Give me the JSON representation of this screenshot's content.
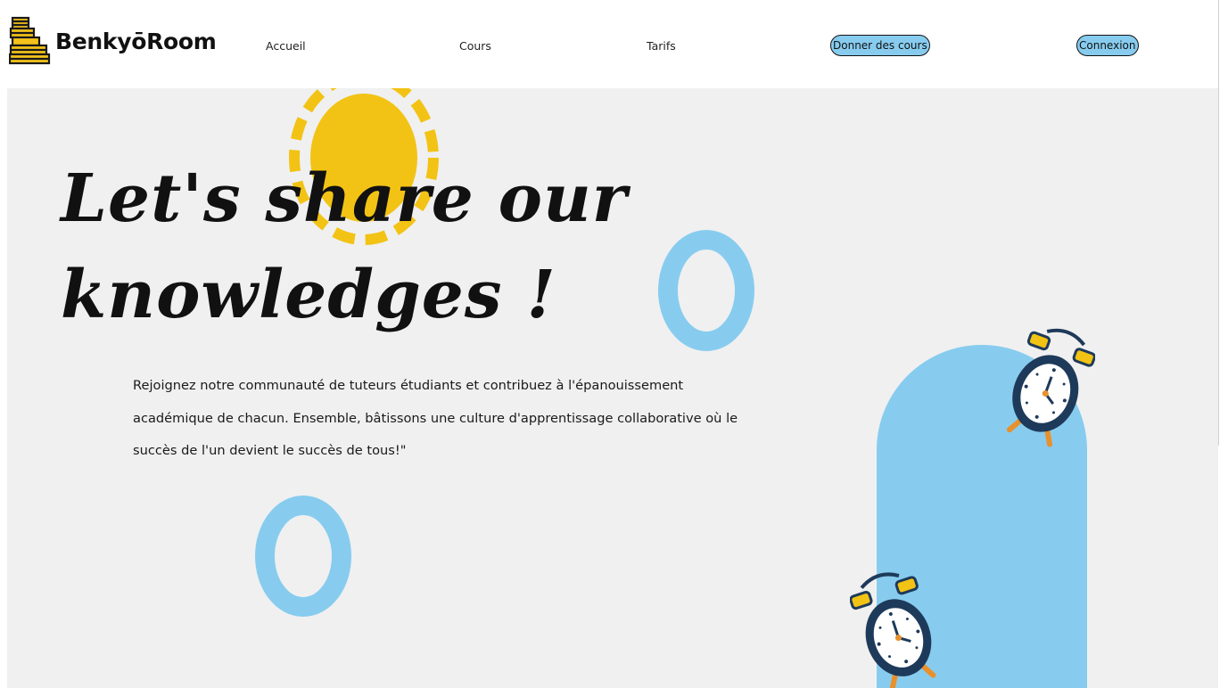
{
  "header": {
    "brand": "BenkyōRoom",
    "logo_icon": "book-stack-icon",
    "nav": {
      "home": "Accueil",
      "courses": "Cours",
      "pricing": "Tarifs"
    },
    "teach_button": "Donner des cours",
    "login_button": "Connexion"
  },
  "hero": {
    "headline_line1": "Let's share our",
    "headline_line2": "knowledges !",
    "intro": "Rejoignez notre communauté de tuteurs étudiants et contribuez à l'épanouissement académique de chacun. Ensemble, bâtissons une culture d'apprentissage collaborative où le succès de l'un devient le succès de tous!\""
  },
  "decorations": {
    "sun_icon": "sun-icon",
    "ring_icon": "ring-icon",
    "clock_icon": "alarm-clock-icon"
  },
  "colors": {
    "accent_blue": "#87ccef",
    "sun_yellow": "#f2c314",
    "logo_yellow": "#f4c21a",
    "hero_background": "#f0f0f0"
  }
}
